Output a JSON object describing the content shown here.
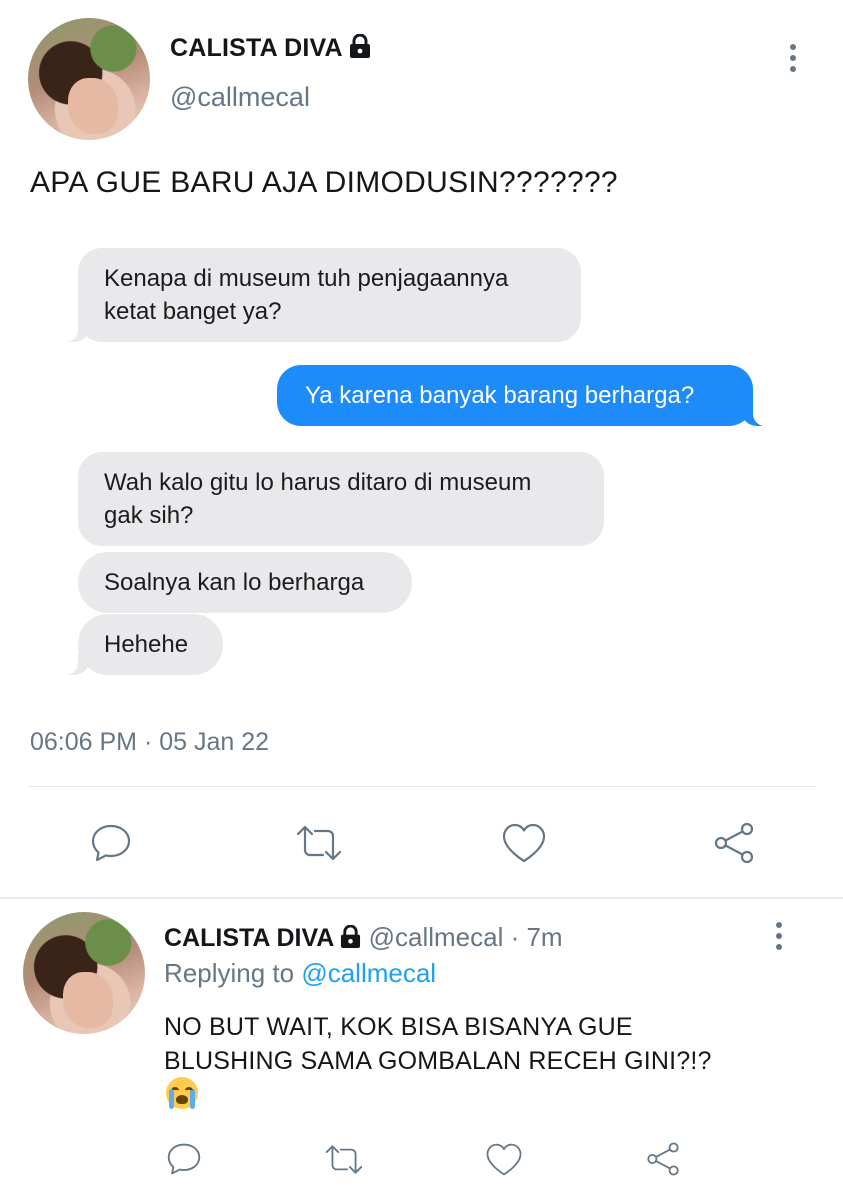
{
  "tweet": {
    "author_name": "CALISTA DIVA",
    "handle": "@callmecal",
    "text": "APA GUE BARU AJA DIMODUSIN???????",
    "timestamp": "06:06 PM · 05 Jan 22"
  },
  "chat": {
    "messages": [
      {
        "side": "left",
        "text_lines": [
          "Kenapa di museum tuh penjagaannya",
          "ketat banget ya?"
        ]
      },
      {
        "side": "right",
        "text_lines": [
          "Ya karena banyak barang berharga?"
        ]
      },
      {
        "side": "left",
        "text_lines": [
          "Wah kalo gitu lo harus ditaro di museum",
          "gak sih?"
        ]
      },
      {
        "side": "left",
        "text_lines": [
          "Soalnya kan lo berharga"
        ]
      },
      {
        "side": "left",
        "text_lines": [
          "Hehehe"
        ]
      }
    ]
  },
  "reply": {
    "author_name": "CALISTA DIVA",
    "meta": "@callmecal · 7m",
    "replying_prefix": "Replying to",
    "replying_to": "@callmecal",
    "text_line1": "NO BUT WAIT, KOK BISA BISANYA GUE",
    "text_line2": "BLUSHING SAMA GOMBALAN RECEH GINI?!?",
    "emoji": "loudly-crying-face"
  },
  "icons": {
    "lock": "lock-icon",
    "more": "more-vertical-icon",
    "reply": "reply-icon",
    "retweet": "retweet-icon",
    "like": "heart-icon",
    "share": "share-icon"
  },
  "colors": {
    "accent": "#1da1f2",
    "bubble_blue": "#1e8bfb",
    "bubble_gray": "#e9e9eb",
    "muted": "#657786"
  }
}
